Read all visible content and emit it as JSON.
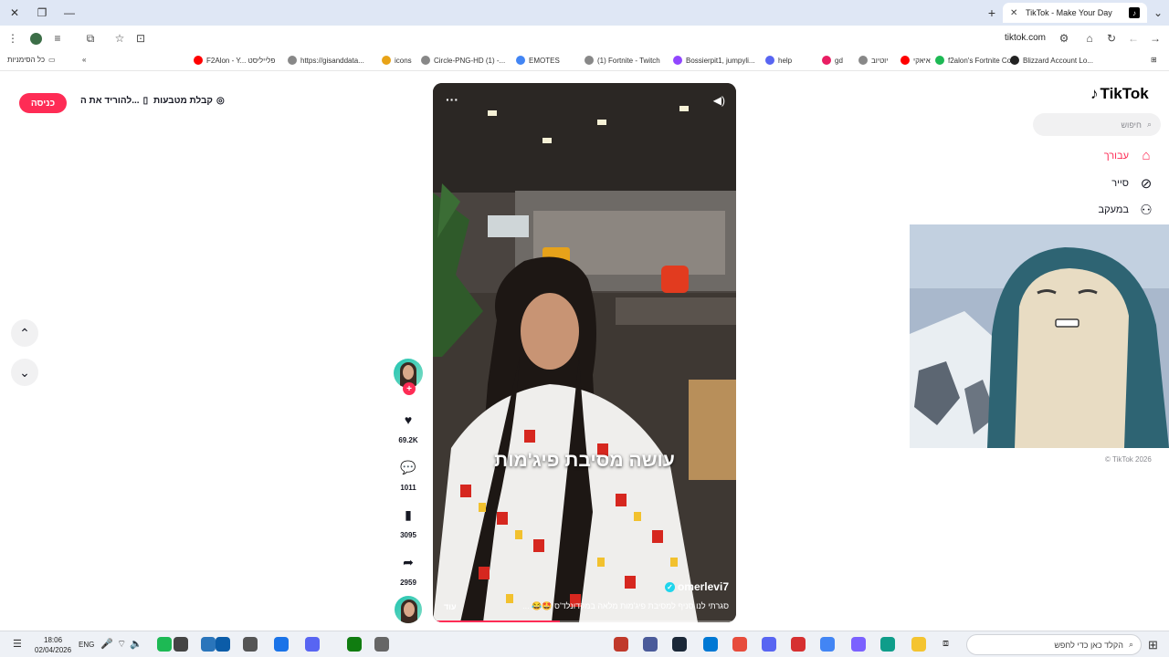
{
  "browser": {
    "tab_title": "TikTok - Make Your Day",
    "url": "tiktok.com",
    "bookmarks": [
      {
        "label": "F2Alon - Y... פלייליסט",
        "color": "#ff0000"
      },
      {
        "label": "https://gisanddata...",
        "color": "#888888"
      },
      {
        "label": "icons",
        "color": "#e8a317"
      },
      {
        "label": "Circle-PNG-HD (1) -...",
        "color": "#888888"
      },
      {
        "label": "EMOTES",
        "color": "#4285f4"
      },
      {
        "label": "(1) Fortnite - Twitch",
        "color": "#888888"
      },
      {
        "label": "Bossierpit1, jumpyli...",
        "color": "#9146ff"
      },
      {
        "label": "help",
        "color": "#5865f2"
      },
      {
        "label": "gd",
        "color": "#e91e63"
      },
      {
        "label": "יוטיוב",
        "color": "#888888"
      },
      {
        "label": "איאקי",
        "color": "#ff0000"
      },
      {
        "label": "f2alon's Fortnite Co...",
        "color": "#1db954"
      },
      {
        "label": "Blizzard Account Lo...",
        "color": "#222222"
      }
    ],
    "all_bookmarks": "כל הסימניות"
  },
  "header": {
    "login": "כניסה",
    "download": "להוריד את ה...",
    "coins": "קבלת מטבעות"
  },
  "video": {
    "caption": "עושה מסיבת פיג'מות",
    "author": "omerlevi7",
    "description": "סגרתי לנו סניף למסיבת פיג'מות מלאה במקדונלד'ס 🤩😂 ...",
    "more": "עוד",
    "progress": 0.42
  },
  "actions": {
    "likes": "69.2K",
    "comments": "1011",
    "saves": "3095",
    "shares": "2959"
  },
  "sidebar": {
    "logo": "TikTok",
    "search_placeholder": "חיפוש",
    "items": [
      {
        "label": "עבורך",
        "icon": "home-icon"
      },
      {
        "label": "סייר",
        "icon": "compass-icon"
      },
      {
        "label": "במעקב",
        "icon": "following-icon"
      }
    ],
    "copyright": "© TikTok 2026"
  },
  "taskbar": {
    "time": "18:06",
    "date": "02/04/2026",
    "language": "ENG",
    "search_placeholder": "הקלד כאן כדי לחפש"
  },
  "colors": {
    "accent": "#fe2c55",
    "verified": "#20d5ec"
  }
}
